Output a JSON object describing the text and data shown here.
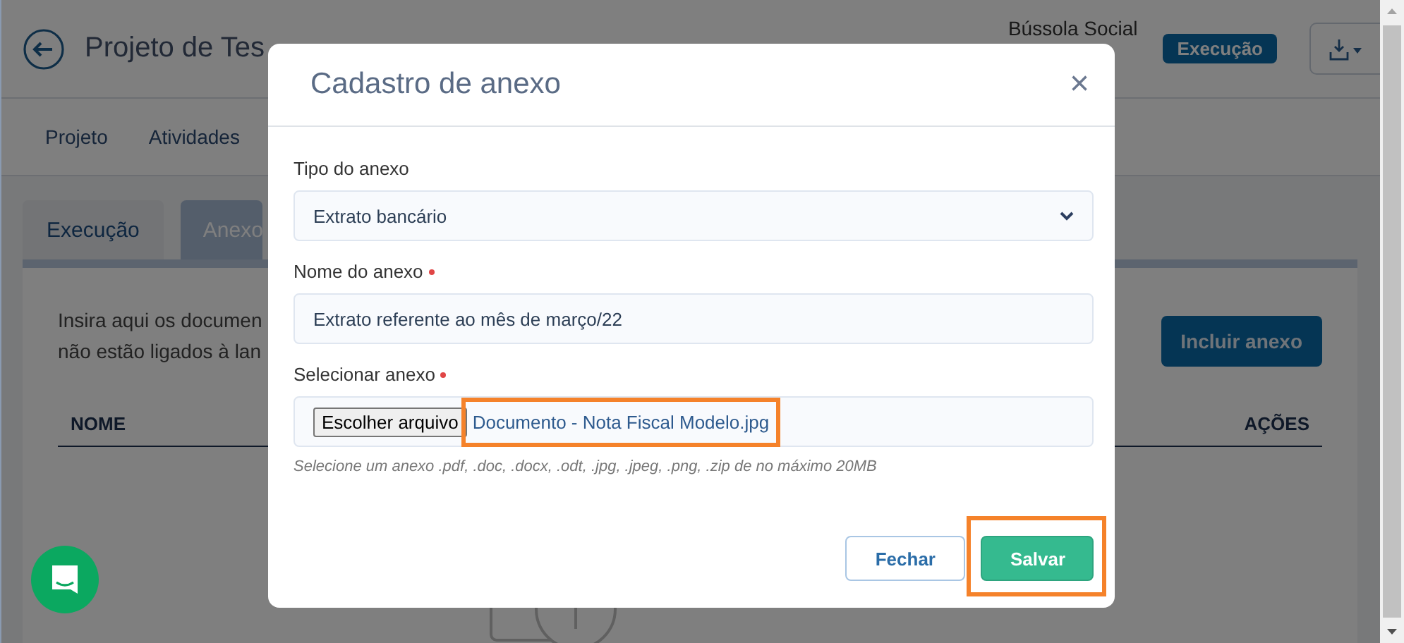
{
  "header": {
    "title": "Projeto de Tes",
    "organization": "Bússola Social",
    "status_badge": "Execução"
  },
  "nav": [
    {
      "label": "Projeto"
    },
    {
      "label": "Atividades"
    }
  ],
  "tabs": [
    {
      "label": "Execução",
      "selected": false
    },
    {
      "label": "Anexo",
      "selected": true
    }
  ],
  "panel": {
    "description_lines": [
      "Insira aqui os documen",
      "não estão ligados à lan"
    ],
    "add_button": "Incluir anexo",
    "columns": [
      "NOME",
      "AÇÕES"
    ]
  },
  "modal": {
    "title": "Cadastro de anexo",
    "fields": [
      {
        "kind": "select",
        "label": "Tipo do anexo",
        "required": false,
        "value": "Extrato bancário"
      },
      {
        "kind": "text",
        "label": "Nome do anexo",
        "required": true,
        "value": "Extrato referente ao mês de março/22"
      },
      {
        "kind": "file",
        "label": "Selecionar anexo",
        "required": true,
        "button": "Escolher arquivo",
        "value": "Documento - Nota Fiscal Modelo.jpg",
        "hint": "Selecione um anexo .pdf, .doc, .docx, .odt, .jpg, .jpeg, .png, .zip de no máximo 20MB",
        "highlighted": true
      }
    ],
    "buttons": [
      {
        "kind": "secondary",
        "label": "Fechar",
        "highlighted": false
      },
      {
        "kind": "primary",
        "label": "Salvar",
        "highlighted": true
      }
    ],
    "close": "×"
  }
}
